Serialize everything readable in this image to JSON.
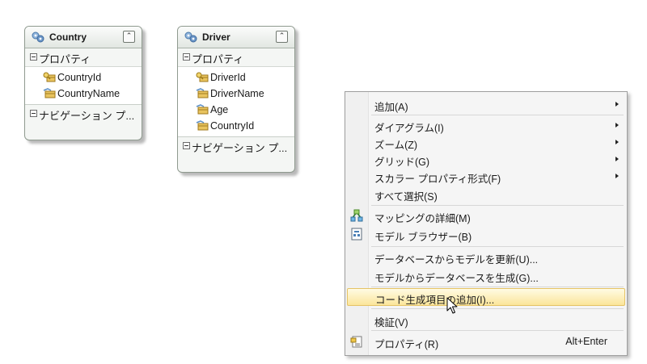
{
  "entities": [
    {
      "id": "country",
      "title": "Country",
      "properties_header": "プロパティ",
      "properties": [
        {
          "name": "CountryId",
          "key": true
        },
        {
          "name": "CountryName",
          "key": false
        }
      ],
      "navigation_header": "ナビゲーション プ..."
    },
    {
      "id": "driver",
      "title": "Driver",
      "properties_header": "プロパティ",
      "properties": [
        {
          "name": "DriverId",
          "key": true
        },
        {
          "name": "DriverName",
          "key": false
        },
        {
          "name": "Age",
          "key": false
        },
        {
          "name": "CountryId",
          "key": false
        }
      ],
      "navigation_header": "ナビゲーション プ..."
    }
  ],
  "context_menu": {
    "items": [
      {
        "label": "追加(A)",
        "submenu": true
      },
      {
        "separator": true
      },
      {
        "label": "ダイアグラム(I)",
        "submenu": true
      },
      {
        "label": "ズーム(Z)",
        "submenu": true
      },
      {
        "label": "グリッド(G)",
        "submenu": true
      },
      {
        "label": "スカラー プロパティ形式(F)",
        "submenu": true
      },
      {
        "label": "すべて選択(S)"
      },
      {
        "separator": true
      },
      {
        "label": "マッピングの詳細(M)",
        "icon": "mapping-details-icon"
      },
      {
        "label": "モデル ブラウザー(B)",
        "icon": "model-browser-icon"
      },
      {
        "separator": true
      },
      {
        "label": "データベースからモデルを更新(U)..."
      },
      {
        "label": "モデルからデータベースを生成(G)..."
      },
      {
        "separator": true
      },
      {
        "label": "コード生成項目の追加(I)...",
        "highlighted": true
      },
      {
        "separator": true
      },
      {
        "label": "検証(V)"
      },
      {
        "separator": true
      },
      {
        "label": "プロパティ(R)",
        "shortcut": "Alt+Enter",
        "icon": "properties-icon"
      }
    ]
  },
  "colors": {
    "entity_border": "#8f9a8f",
    "menu_highlight": "#fbe59a",
    "menu_background": "#f5f5f5"
  }
}
